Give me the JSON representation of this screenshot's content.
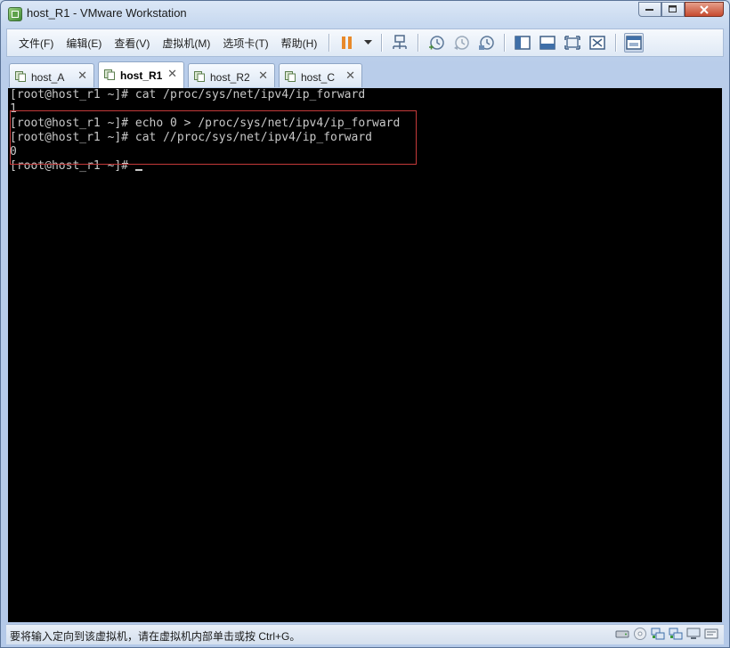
{
  "window": {
    "title": "host_R1 - VMware Workstation"
  },
  "menu": {
    "items": [
      {
        "label": "文件(F)"
      },
      {
        "label": "编辑(E)"
      },
      {
        "label": "查看(V)"
      },
      {
        "label": "虚拟机(M)"
      },
      {
        "label": "选项卡(T)"
      },
      {
        "label": "帮助(H)"
      }
    ]
  },
  "toolbar": {
    "icons": [
      "pause-icon",
      "dropdown-arrow-icon",
      "network-icon",
      "snapshot-take-icon",
      "snapshot-revert-icon",
      "snapshot-manager-icon",
      "sidebar-icon",
      "console-view-icon",
      "fullscreen-icon",
      "unity-icon",
      "thumbnail-icon"
    ]
  },
  "tabs": [
    {
      "label": "host_A",
      "active": false
    },
    {
      "label": "host_R1",
      "active": true
    },
    {
      "label": "host_R2",
      "active": false
    },
    {
      "label": "host_C",
      "active": false
    }
  ],
  "console": {
    "lines": [
      "[root@host_r1 ~]# cat /proc/sys/net/ipv4/ip_forward",
      "1",
      "[root@host_r1 ~]# echo 0 > /proc/sys/net/ipv4/ip_forward",
      "[root@host_r1 ~]# cat //proc/sys/net/ipv4/ip_forward",
      "0",
      "[root@host_r1 ~]# "
    ]
  },
  "status": {
    "text": "要将输入定向到该虚拟机，请在虚拟机内部单击或按 Ctrl+G。"
  },
  "colors": {
    "highlight_box": "#c43a3a",
    "console_bg": "#000000",
    "console_fg": "#c8c8c8"
  }
}
